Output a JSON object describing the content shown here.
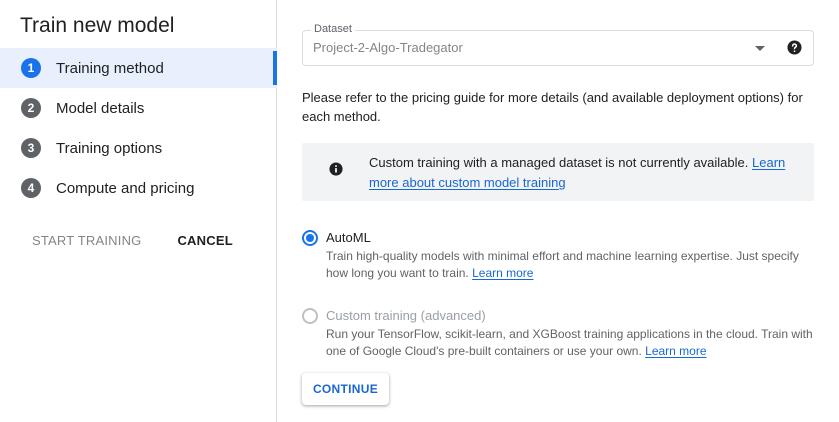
{
  "sidebar": {
    "title": "Train new model",
    "steps": [
      {
        "number": "1",
        "label": "Training method",
        "active": true
      },
      {
        "number": "2",
        "label": "Model details"
      },
      {
        "number": "3",
        "label": "Training options"
      },
      {
        "number": "4",
        "label": "Compute and pricing"
      }
    ],
    "start_training_label": "START TRAINING",
    "cancel_label": "CANCEL"
  },
  "main": {
    "dataset": {
      "label": "Dataset",
      "value": "Project-2-Algo-Tradegator"
    },
    "pricing_text": "Please refer to the pricing guide for more details (and available deployment options) for each method.",
    "info_box": {
      "text": "Custom training with a managed dataset is not currently available.",
      "link": "Learn more about custom model training"
    },
    "options": {
      "automl": {
        "title": "AutoML",
        "selected": true,
        "description": "Train high-quality models with minimal effort and machine learning expertise. Just specify how long you want to train.",
        "link": "Learn more"
      },
      "custom": {
        "title": "Custom training (advanced)",
        "selected": false,
        "description": "Run your TensorFlow, scikit-learn, and XGBoost training applications in the cloud. Train with one of Google Cloud's pre-built containers or use your own.",
        "link": "Learn more"
      }
    },
    "continue_label": "CONTINUE"
  },
  "icons": {
    "help": "help-icon",
    "info": "info-icon",
    "dropdown": "chevron-down-icon"
  },
  "colors": {
    "accent": "#1a73e8",
    "link": "#1967d2",
    "info_bg": "#f1f3f4",
    "active_step_bg": "#e8f0fe"
  }
}
